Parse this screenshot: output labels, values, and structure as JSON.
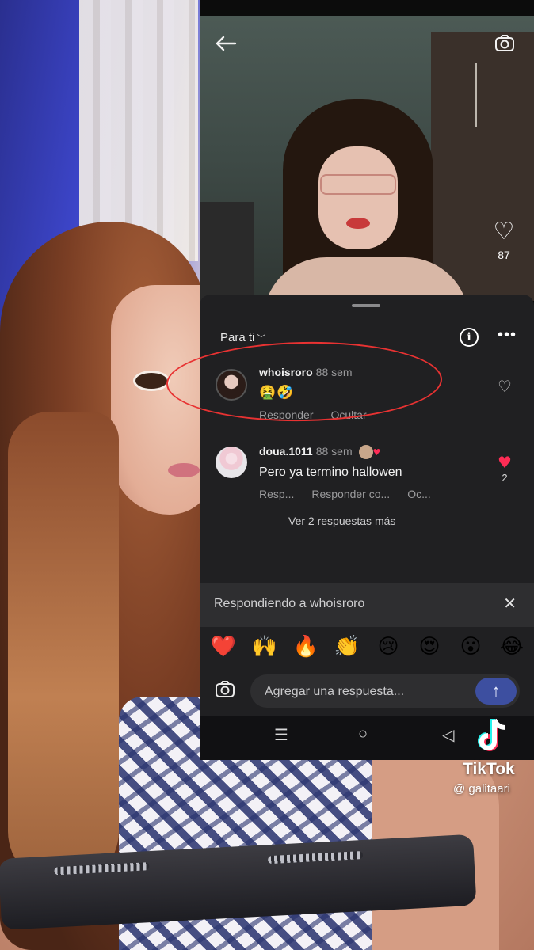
{
  "video": {
    "like_count": "87"
  },
  "comments_sheet": {
    "filter_label": "Para ti",
    "comments": [
      {
        "username": "whoisroro",
        "time": "88 sem",
        "text": "🤮🤣",
        "actions": [
          "Responder",
          "Ocultar"
        ]
      },
      {
        "username": "doua.1011",
        "time": "88 sem",
        "text": "Pero ya termino hallowen",
        "actions": [
          "Resp...",
          "Responder co...",
          "Oc..."
        ],
        "like_count": "2",
        "badge": "♥"
      }
    ],
    "more_replies_label": "Ver 2 respuestas más"
  },
  "reply_bar": {
    "replying_to_label": "Respondiendo a whoisroro",
    "emojis": [
      "❤️",
      "🙌",
      "🔥",
      "👏",
      "😢",
      "😍",
      "😮",
      "😂"
    ],
    "input_placeholder": "Agregar una respuesta..."
  },
  "watermark": {
    "brand": "TikTok",
    "username": "@ galitaari"
  },
  "colors": {
    "annotation_circle": "#e83232",
    "like_active": "#fe2c55",
    "send_button": "#3d4fa0",
    "sheet_bg": "#202022"
  }
}
